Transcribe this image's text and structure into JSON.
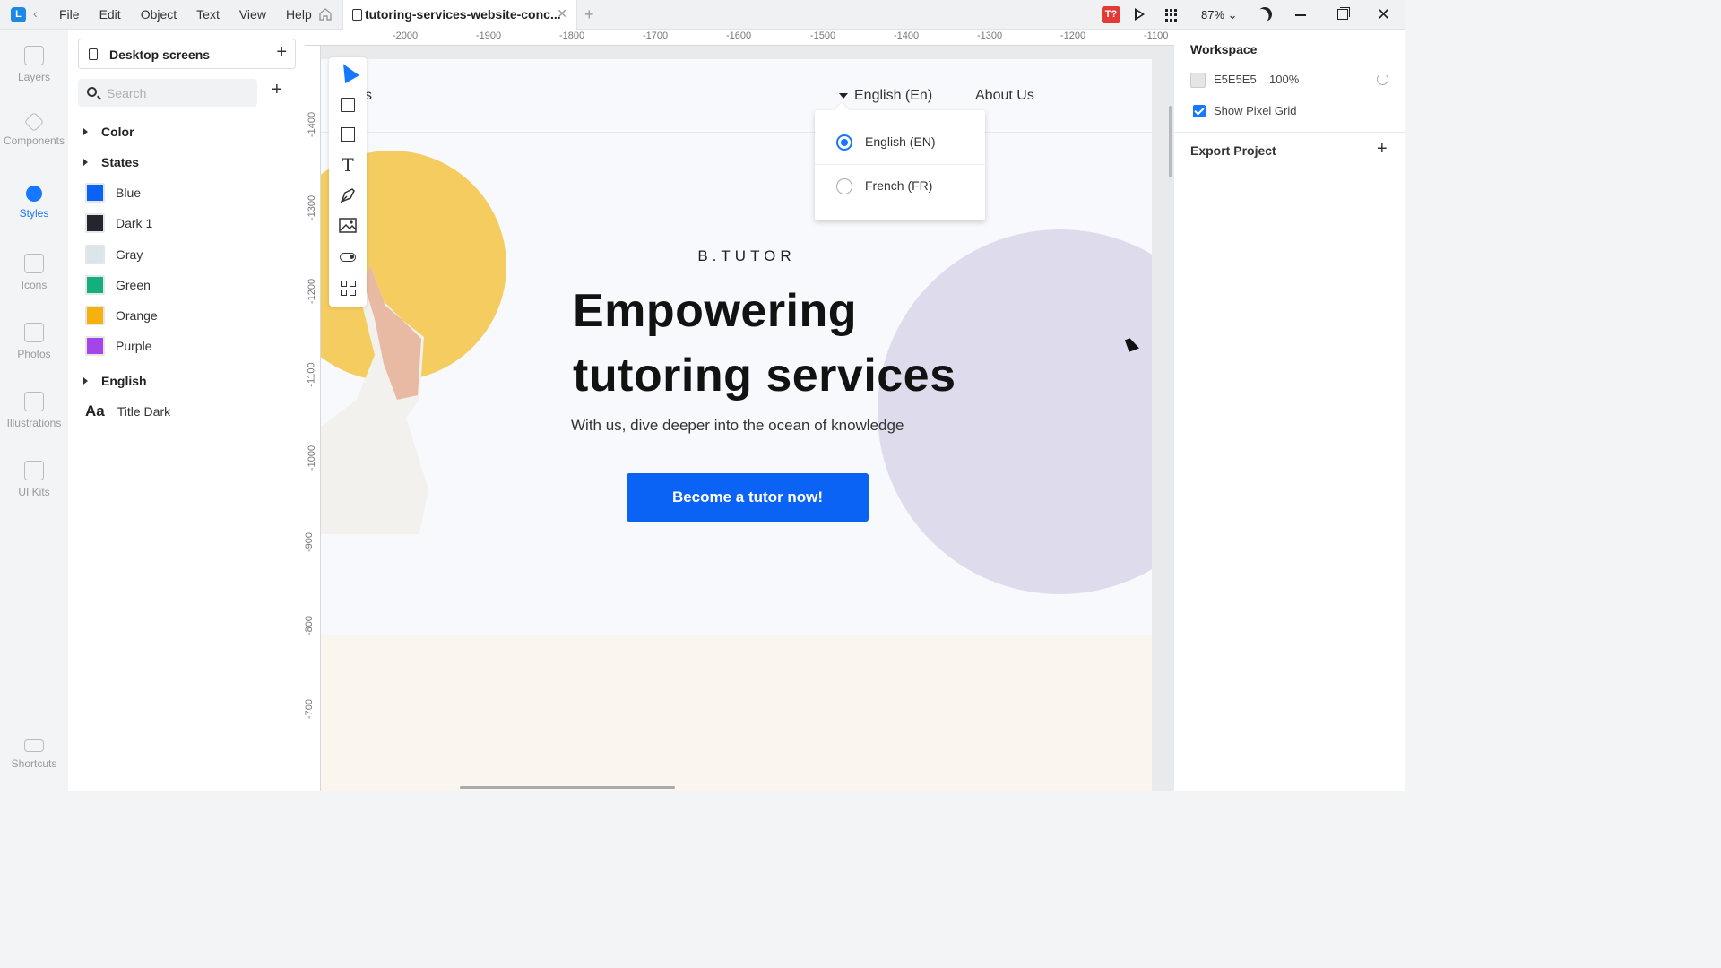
{
  "titlebar": {
    "menu": [
      "File",
      "Edit",
      "Object",
      "Text",
      "View",
      "Help"
    ],
    "tab_title": "tutoring-services-website-conc...",
    "user_badge": "T?",
    "zoom": "87%"
  },
  "rail": [
    {
      "label": "Layers"
    },
    {
      "label": "Components"
    },
    {
      "label": "Styles"
    },
    {
      "label": "Icons"
    },
    {
      "label": "Photos"
    },
    {
      "label": "Illustrations"
    },
    {
      "label": "UI Kits"
    },
    {
      "label": "Shortcuts"
    }
  ],
  "left_panel": {
    "page_selector": "Desktop screens",
    "search_placeholder": "Search",
    "groups": {
      "color": "Color",
      "states": "States",
      "english": "English"
    },
    "swatches": [
      {
        "name": "Blue",
        "color": "#0b63f6"
      },
      {
        "name": "Dark 1",
        "color": "#23262d"
      },
      {
        "name": "Gray",
        "color": "#dbe6ea"
      },
      {
        "name": "Green",
        "color": "#13b07e"
      },
      {
        "name": "Orange",
        "color": "#f5b20e"
      },
      {
        "name": "Purple",
        "color": "#a445ea"
      }
    ],
    "text_style": {
      "preview": "Aa",
      "name": "Title Dark"
    }
  },
  "rulers": {
    "top": [
      "-2000",
      "-1900",
      "-1800",
      "-1700",
      "-1600",
      "-1500",
      "-1400",
      "-1300",
      "-1200",
      "-1100"
    ],
    "left": [
      "-1400",
      "-1300",
      "-1200",
      "-1100",
      "-1000",
      "-900",
      "-800",
      "-700"
    ]
  },
  "artboard": {
    "nav_partial": "s",
    "nav_language": "English (En)",
    "nav_about": "About Us",
    "brand": "B.TUTOR",
    "headline_line1": "Empowering",
    "headline_line2": "tutoring services",
    "subline": "With us, dive deeper into the ocean of knowledge",
    "cta": "Become a tutor now!"
  },
  "language_dropdown": {
    "options": [
      {
        "label": "English (EN)",
        "selected": true
      },
      {
        "label": "French (FR)",
        "selected": false
      }
    ]
  },
  "right_panel": {
    "workspace_title": "Workspace",
    "workspace_color": "E5E5E5",
    "workspace_opacity": "100%",
    "show_pixel_grid": "Show Pixel Grid",
    "export_project": "Export Project"
  }
}
